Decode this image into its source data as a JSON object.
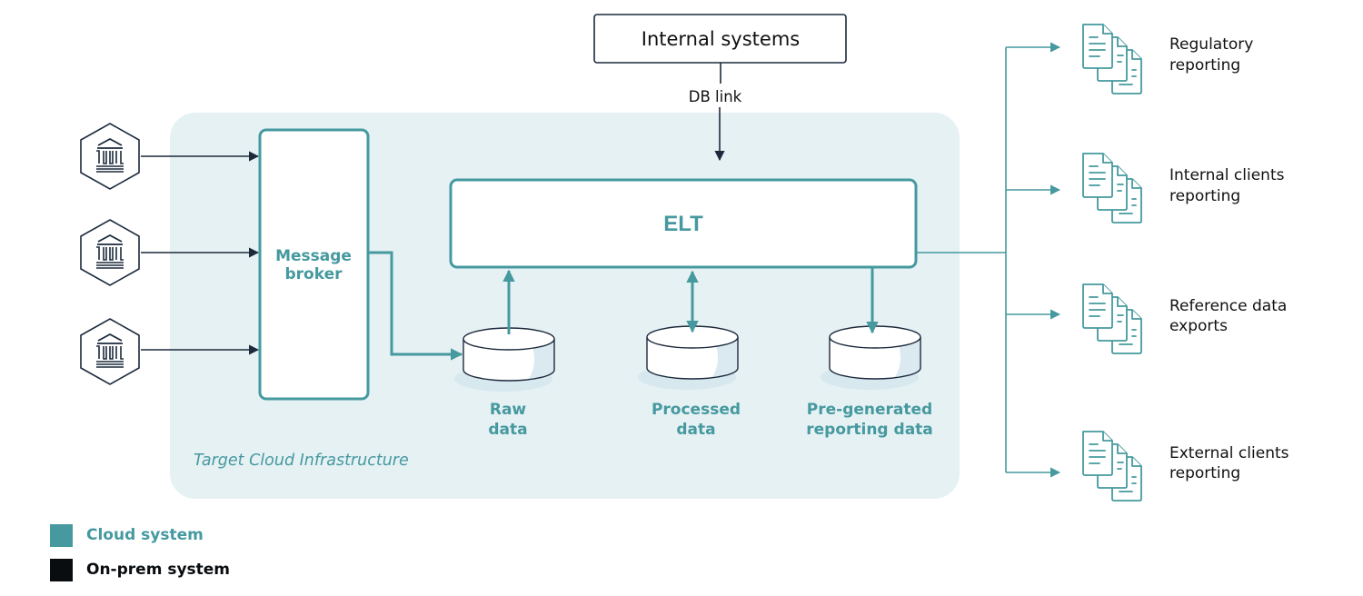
{
  "colors": {
    "teal": "#45999f",
    "navy": "#1c2a3c",
    "cloud_bg": "#e6f1f4",
    "black": "#0a0d10",
    "cylinder_shade": "#dbeaf0"
  },
  "internal_systems": {
    "label": "Internal systems",
    "link_label": "DB link"
  },
  "cloud": {
    "region_label": "Target Cloud Infrastructure",
    "message_broker": {
      "line1": "Message",
      "line2": "broker"
    },
    "elt": {
      "label": "ELT"
    },
    "stores": [
      {
        "line1": "Raw",
        "line2": "data",
        "arrow": "up"
      },
      {
        "line1": "Processed",
        "line2": "data",
        "arrow": "both"
      },
      {
        "line1": "Pre-generated",
        "line2": "reporting data",
        "arrow": "down"
      }
    ]
  },
  "sources": [
    {
      "icon": "bank-icon"
    },
    {
      "icon": "bank-icon"
    },
    {
      "icon": "bank-icon"
    }
  ],
  "outputs": [
    {
      "line1": "Regulatory",
      "line2": "reporting",
      "icon": "documents-icon"
    },
    {
      "line1": "Internal clients",
      "line2": "reporting",
      "icon": "documents-icon"
    },
    {
      "line1": "Reference data",
      "line2": "exports",
      "icon": "documents-icon"
    },
    {
      "line1": "External clients",
      "line2": "reporting",
      "icon": "documents-icon"
    }
  ],
  "legend": [
    {
      "label": "Cloud system",
      "color": "#45999f"
    },
    {
      "label": "On-prem system",
      "color": "#0a0d10"
    }
  ]
}
